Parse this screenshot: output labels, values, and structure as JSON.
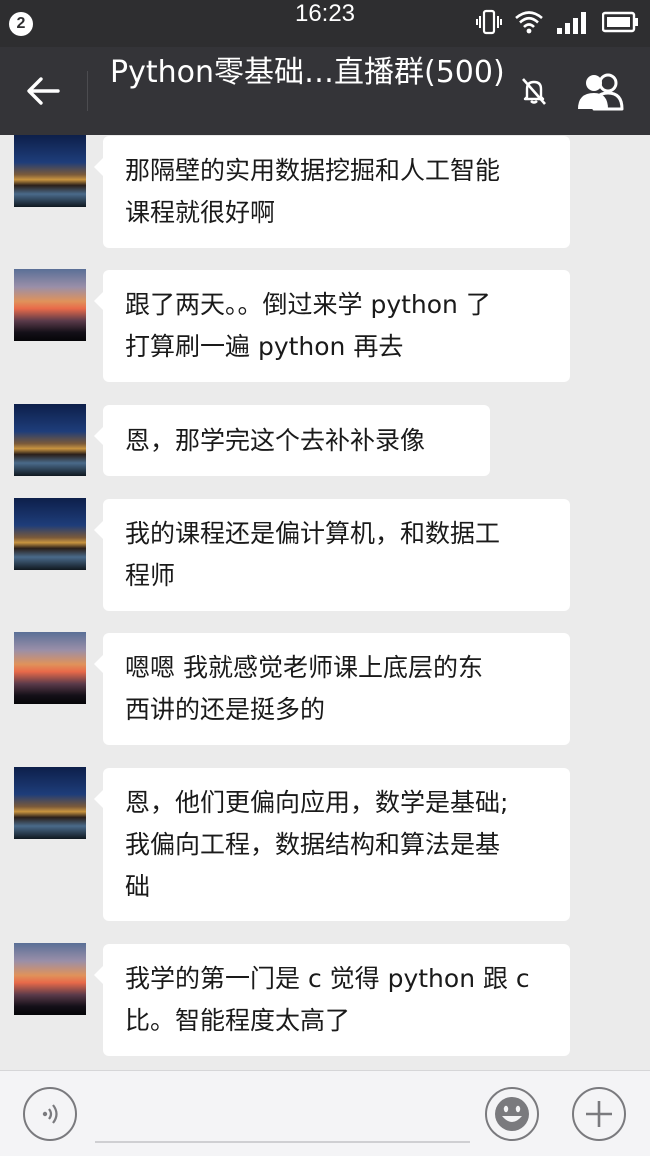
{
  "status_bar": {
    "notification_count": "2",
    "time": "16:23",
    "icons": [
      "vibrate-icon",
      "wifi-icon",
      "signal-icon",
      "battery-icon"
    ]
  },
  "header": {
    "title": "Python零基础…直播群(500)",
    "icons": [
      "back-arrow-icon",
      "mute-bell-icon",
      "group-members-icon"
    ]
  },
  "messages": [
    {
      "avatar": "night",
      "text": "那隔壁的实用数据挖掘和人工智能\n课程就很好啊"
    },
    {
      "avatar": "sunset",
      "text": "跟了两天。。倒过来学 python 了\n打算刷一遍 python 再去"
    },
    {
      "avatar": "night",
      "text": "恩，那学完这个去补补录像"
    },
    {
      "avatar": "night",
      "text": "我的课程还是偏计算机，和数据工\n程师"
    },
    {
      "avatar": "sunset",
      "text": "嗯嗯  我就感觉老师课上底层的东\n西讲的还是挺多的"
    },
    {
      "avatar": "night",
      "text": "恩，他们更偏向应用，数学是基础;\n我偏向工程，数据结构和算法是基\n础"
    },
    {
      "avatar": "sunset",
      "text": "我学的第一门是 c  觉得 python 跟 c\n比。智能程度太高了"
    }
  ],
  "input_bar": {
    "placeholder": "",
    "icons": [
      "voice-icon",
      "emoji-icon",
      "plus-icon"
    ]
  },
  "colors": {
    "status_bar_bg": "#2e2e30",
    "title_bar_bg": "#343438",
    "chat_bg": "#ebebeb",
    "bubble_bg": "#ffffff"
  }
}
